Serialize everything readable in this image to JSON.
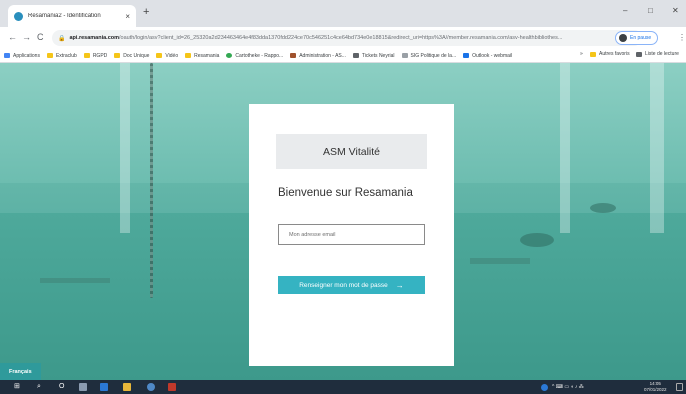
{
  "browser": {
    "tab_title": "Resamania2 - Identification",
    "tab_close": "×",
    "new_tab": "+",
    "window_controls": {
      "minimize": "–",
      "maximize": "□",
      "close": "✕"
    },
    "nav": {
      "back": "←",
      "forward": "→",
      "reload": "C"
    },
    "url_domain": "api.resamania.com",
    "url_rest": "/oauth/login/asv?client_id=26_25320a2d234463464e4f83dda1370fdd224ce70c546251c4ce64bd734e0e18815&redirect_uri=https%3A//member.resamania.com/asv-healthbibliothes...",
    "lock_icon": "🔒",
    "star_icon": "★",
    "pause_label": "En pause",
    "menu_icon": "⋮",
    "bookmarks": [
      {
        "label": "Applications",
        "color": "#4285f4"
      },
      {
        "label": "Extraclub",
        "color": "#f5c518"
      },
      {
        "label": "RGPD",
        "color": "#f5c518"
      },
      {
        "label": "Doc Unique",
        "color": "#f5c518"
      },
      {
        "label": "Vidéo",
        "color": "#f5c518"
      },
      {
        "label": "Resamania",
        "color": "#f5c518"
      },
      {
        "label": "Cartotheke - Rappo...",
        "color": "#34a853"
      },
      {
        "label": "Administration - AS...",
        "color": "#a0522d"
      },
      {
        "label": "Tickets Neyrial",
        "color": "#5f6368"
      },
      {
        "label": "SIG Politique de la...",
        "color": "#9aa0a6"
      },
      {
        "label": "Outlook - webmail",
        "color": "#1a73e8"
      }
    ],
    "bookmarks_more": "»",
    "bookmarks_other": "Autres favoris",
    "reading_list": "Liste de lecture"
  },
  "login": {
    "brand": "ASM Vitalité",
    "welcome": "Bienvenue sur Resamania",
    "email_placeholder": "Mon adresse email",
    "submit_label": "Renseigner mon mot de passe",
    "submit_arrow": "→"
  },
  "language": "Français",
  "taskbar": {
    "start_icon": "⊞",
    "search_icon": "⌕",
    "taskview_icon": "O",
    "tray_icons": "^ ⌨ ▭ ◖ ♪ ⁂",
    "time": "14:05",
    "date": "07/01/2022"
  },
  "colors": {
    "accent": "#35b3c2",
    "language_badge": "#2f9a9b",
    "taskbar": "#1f2d3d"
  }
}
